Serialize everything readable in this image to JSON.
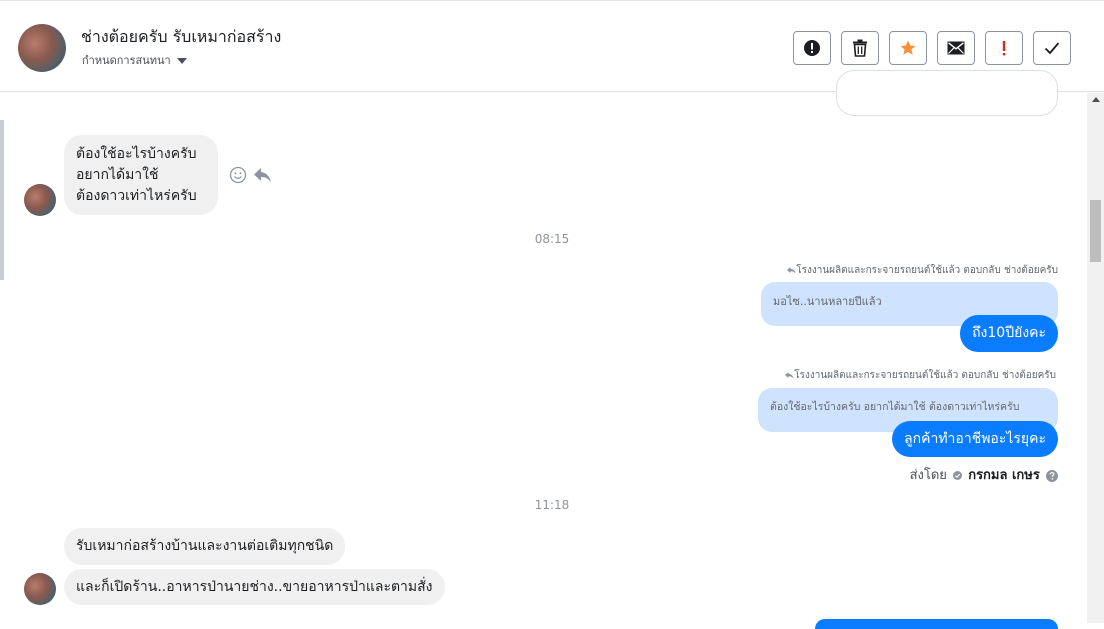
{
  "header": {
    "title": "ช่างต้อยครับ รับเหมาก่อสร้าง",
    "subtitle": "กำหนดการสนทนา",
    "actions": [
      {
        "name": "spam-button",
        "icon": "exclamation-circle-icon"
      },
      {
        "name": "delete-button",
        "icon": "trash-icon"
      },
      {
        "name": "star-button",
        "icon": "star-icon"
      },
      {
        "name": "mark-unread-button",
        "icon": "envelope-icon"
      },
      {
        "name": "follow-up-button",
        "icon": "exclamation-icon"
      },
      {
        "name": "mark-done-button",
        "icon": "checkmark-icon"
      }
    ]
  },
  "colors": {
    "accent_blue": "#0a7cff",
    "quote_blue": "#cfe3ff",
    "star_orange": "#f7923a",
    "alert_red": "#e02424",
    "gray_bubble": "#f0f0f0"
  },
  "messages": {
    "incoming_1": {
      "lines": [
        "ต้องใช้อะไรบ้างครับ",
        "อยากได้มาใช้",
        "ต้องดาวเท่าไหร่ครับ"
      ]
    },
    "time_1": "08:15",
    "reply_1": {
      "meta": "โรงงานผลิตและกระจายรถยนต์ใช้แล้ว ตอบกลับ ช่างต้อยครับ",
      "quote": "มอไซ..นานหลายปีแล้ว",
      "text": "ถึง10ปียังคะ"
    },
    "reply_2": {
      "meta": "โรงงานผลิตและกระจายรถยนต์ใช้แล้ว ตอบกลับ ช่างต้อยครับ",
      "quote": "ต้องใช้อะไรบ้างครับ อยากได้มาใช้ ต้องดาวเท่าไหร่ครับ",
      "text": "ลูกค้าทำอาชีพอะไรยุคะ"
    },
    "sent_by": {
      "label": "ส่งโดย",
      "name": "กรกมล เกษร"
    },
    "time_2": "11:18",
    "incoming_2": "รับเหมาก่อสร้างบ้านและงานต่อเติมทุกชนิด",
    "incoming_3": "และก็เปิดร้าน..อาหารป่านายช่าง..ขายอาหารป่าและตามสั่ง"
  }
}
